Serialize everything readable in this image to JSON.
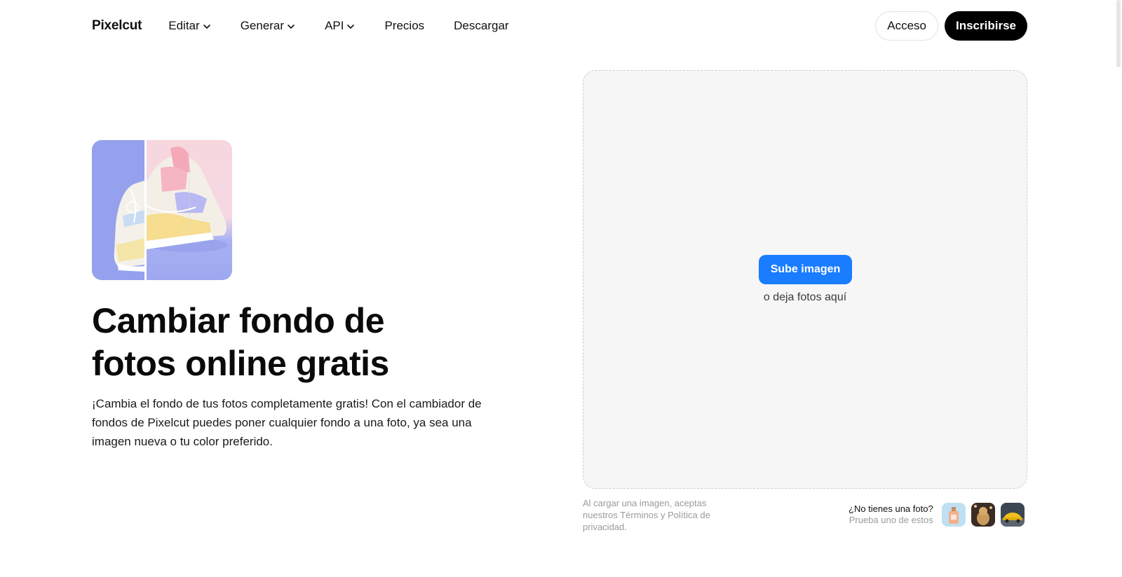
{
  "nav": {
    "logo": "Pixelcut",
    "items": [
      {
        "label": "Editar",
        "dropdown": true
      },
      {
        "label": "Generar",
        "dropdown": true
      },
      {
        "label": "API",
        "dropdown": true
      },
      {
        "label": "Precios",
        "dropdown": false
      },
      {
        "label": "Descargar",
        "dropdown": false
      }
    ],
    "login_label": "Acceso",
    "signup_label": "Inscribirse"
  },
  "hero": {
    "title_line1": "Cambiar fondo de",
    "title_line2": "fotos online gratis",
    "description": "¡Cambia el fondo de tus fotos completamente gratis! Con el cambiador de fondos de Pixelcut puedes poner cualquier fondo a una foto, ya sea una imagen nueva o tu color preferido."
  },
  "dropzone": {
    "upload_label": "Sube imagen",
    "hint": "o deja fotos aquí"
  },
  "terms": "Al cargar una imagen, aceptas nuestros Términos y Política de privacidad.",
  "samples": {
    "question": "¿No tienes una foto?",
    "subtitle": "Prueba uno de estos",
    "thumbs": [
      "perfume-bottle-thumbnail",
      "dog-thumbnail",
      "yellow-car-thumbnail"
    ]
  },
  "colors": {
    "accent": "#1a7cff",
    "signup_bg": "#000000",
    "dropzone_bg": "#f6f6f6"
  }
}
